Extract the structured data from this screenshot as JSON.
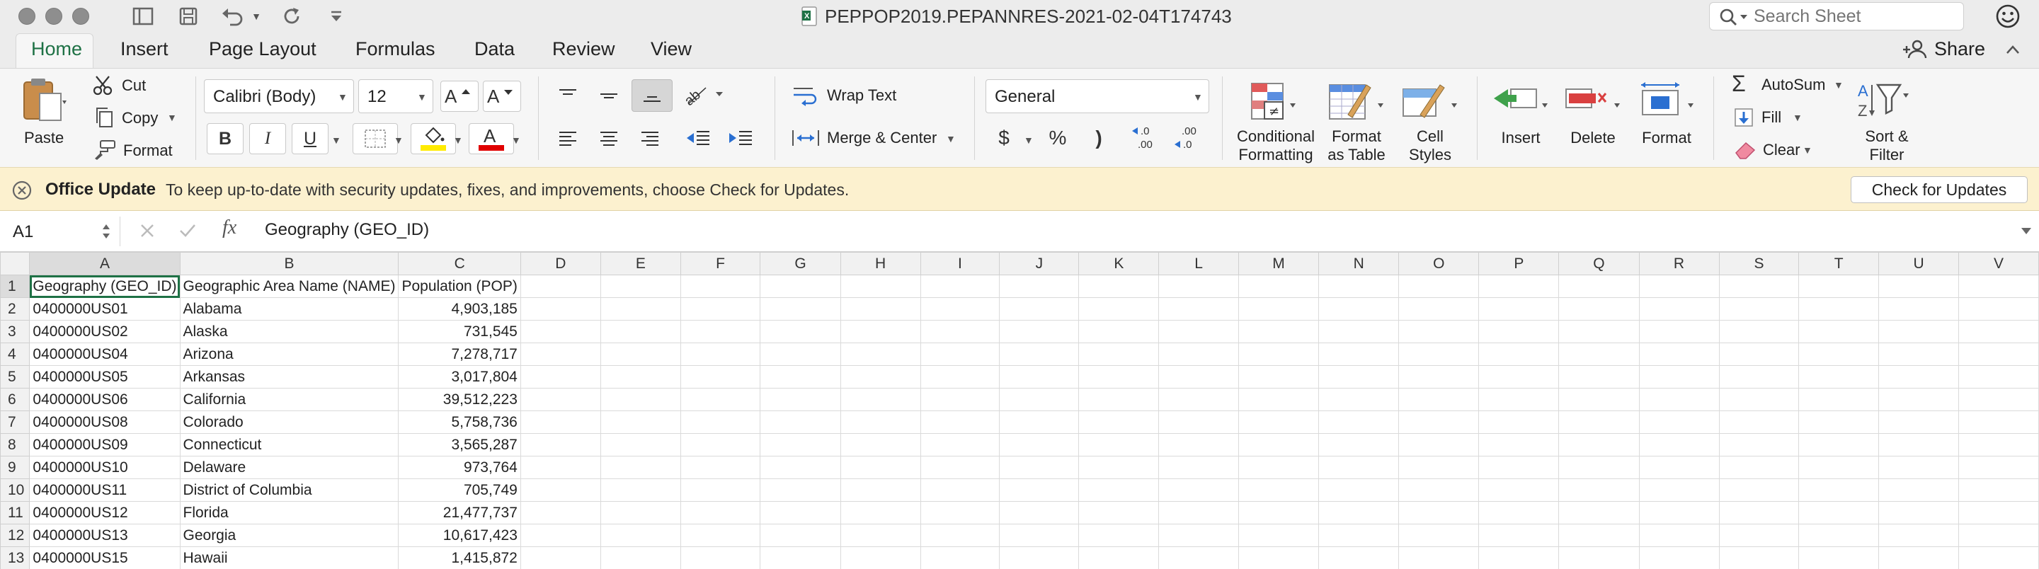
{
  "window": {
    "title": "PEPPOP2019.PEPANNRES-2021-02-04T174743",
    "search_placeholder": "Search Sheet"
  },
  "tabs": [
    "Home",
    "Insert",
    "Page Layout",
    "Formulas",
    "Data",
    "Review",
    "View"
  ],
  "share_label": "Share",
  "ribbon": {
    "paste": "Paste",
    "cut": "Cut",
    "copy": "Copy",
    "format_painter": "Format",
    "font_name": "Calibri (Body)",
    "font_size": "12",
    "bold": "B",
    "italic": "I",
    "underline": "U",
    "wrap_text": "Wrap Text",
    "merge_center": "Merge & Center",
    "number_format": "General",
    "currency": "$",
    "percent": "%",
    "comma": ")",
    "conditional_formatting_1": "Conditional",
    "conditional_formatting_2": "Formatting",
    "format_as_table_1": "Format",
    "format_as_table_2": "as Table",
    "cell_styles_1": "Cell",
    "cell_styles_2": "Styles",
    "insert": "Insert",
    "delete": "Delete",
    "format": "Format",
    "autosum": "AutoSum",
    "fill": "Fill",
    "clear": "Clear",
    "sort_filter_1": "Sort &",
    "sort_filter_2": "Filter"
  },
  "update_bar": {
    "title": "Office Update",
    "message": "To keep up-to-date with security updates, fixes, and improvements, choose Check for Updates.",
    "button": "Check for Updates"
  },
  "formula_bar": {
    "name_box": "A1",
    "fx": "fx",
    "content": "Geography (GEO_ID)"
  },
  "sheet": {
    "columns": [
      "A",
      "B",
      "C",
      "D",
      "E",
      "F",
      "G",
      "H",
      "I",
      "J",
      "K",
      "L",
      "M",
      "N",
      "O",
      "P",
      "Q",
      "R",
      "S",
      "T",
      "U",
      "V"
    ],
    "rows": [
      {
        "n": "1",
        "a": "Geography (GEO_ID)",
        "b": "Geographic Area Name (NAME)",
        "c": "Population (POP)"
      },
      {
        "n": "2",
        "a": "0400000US01",
        "b": "Alabama",
        "c": "4,903,185"
      },
      {
        "n": "3",
        "a": "0400000US02",
        "b": "Alaska",
        "c": "731,545"
      },
      {
        "n": "4",
        "a": "0400000US04",
        "b": "Arizona",
        "c": "7,278,717"
      },
      {
        "n": "5",
        "a": "0400000US05",
        "b": "Arkansas",
        "c": "3,017,804"
      },
      {
        "n": "6",
        "a": "0400000US06",
        "b": "California",
        "c": "39,512,223"
      },
      {
        "n": "7",
        "a": "0400000US08",
        "b": "Colorado",
        "c": "5,758,736"
      },
      {
        "n": "8",
        "a": "0400000US09",
        "b": "Connecticut",
        "c": "3,565,287"
      },
      {
        "n": "9",
        "a": "0400000US10",
        "b": "Delaware",
        "c": "973,764"
      },
      {
        "n": "10",
        "a": "0400000US11",
        "b": "District of Columbia",
        "c": "705,749"
      },
      {
        "n": "11",
        "a": "0400000US12",
        "b": "Florida",
        "c": "21,477,737"
      },
      {
        "n": "12",
        "a": "0400000US13",
        "b": "Georgia",
        "c": "10,617,423"
      },
      {
        "n": "13",
        "a": "0400000US15",
        "b": "Hawaii",
        "c": "1,415,872"
      }
    ]
  },
  "colors": {
    "excel_green": "#1e7145",
    "update_bar": "#fcf1cf",
    "fill_yellow": "#ffeb00",
    "font_red": "#e00000"
  }
}
